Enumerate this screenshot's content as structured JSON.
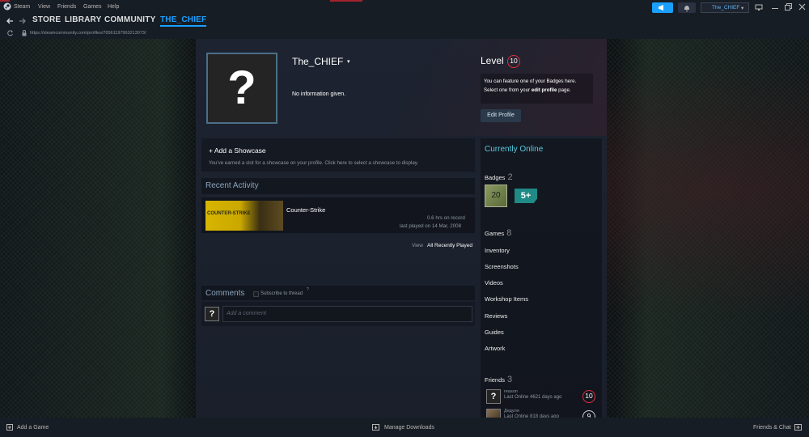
{
  "menu": {
    "steam": "Steam",
    "view": "View",
    "friends": "Friends",
    "games": "Games",
    "help": "Help"
  },
  "account": {
    "user_label": "The_CHIEF",
    "dropdown": "▾",
    "help": "?"
  },
  "nav": {
    "store": "STORE",
    "library": "LIBRARY",
    "community": "COMMUNITY",
    "profile": "THE_CHIEF"
  },
  "url": "https://steamcommunity.com/profiles/76561197963213073/",
  "profile": {
    "avatar_glyph": "?",
    "name": "The_CHIEF",
    "summary": "No information given.",
    "level_label": "Level",
    "level": "10",
    "badge_hint_1": "You can feature one of your Badges here.",
    "badge_hint_2_pre": "Select one from your ",
    "badge_hint_2_link": "edit profile",
    "badge_hint_2_post": " page.",
    "edit_button": "Edit Profile"
  },
  "showcase": {
    "add_label": "+ Add a Showcase",
    "hint": "You've earned a slot for a showcase on your profile. Click here to select a showcase to display."
  },
  "activity": {
    "title": "Recent Activity",
    "game_name": "Counter-Strike",
    "game_logo": "COUNTER-STRIKE",
    "hours": "0.6 hrs on record",
    "last_played": "last played on 14 Mar, 2008",
    "view_label": "View",
    "all_recent": "All Recently Played"
  },
  "comments": {
    "title": "Comments",
    "subscribe": "Subscribe to thread",
    "help": "?",
    "placeholder": "Add a comment",
    "avatar_glyph": "?"
  },
  "sidebar": {
    "status": "Currently Online",
    "badges_label": "Badges",
    "badges_count": "2",
    "badge_1": "20",
    "badge_2": "5+",
    "games_label": "Games",
    "games_count": "8",
    "links": [
      "Inventory",
      "Screenshots",
      "Videos",
      "Workshop Items",
      "Reviews",
      "Guides",
      "Artwork"
    ],
    "friends_label": "Friends",
    "friends_count": "3",
    "friends": [
      {
        "name": "reason",
        "status": "Last Online 4621 days ago",
        "level": "10",
        "avatar": "?"
      },
      {
        "name": "Дедуля",
        "status": "Last Online 818 days ago",
        "level": "9",
        "avatar": ""
      }
    ]
  },
  "statusbar": {
    "add_game": "Add a Game",
    "downloads": "Manage Downloads",
    "friends_chat": "Friends & Chat"
  },
  "colors": {
    "accent_blue": "#1a9fff",
    "level_red": "#e0303c",
    "online_blue": "#57cbde",
    "badge_teal": "#1f8a86"
  }
}
